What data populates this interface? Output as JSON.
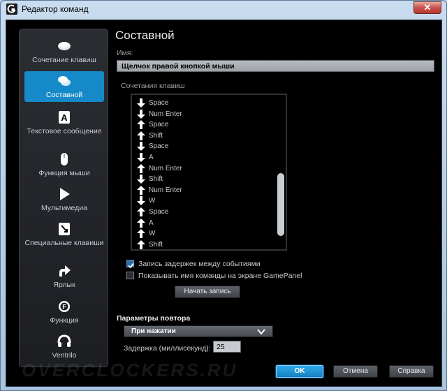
{
  "window": {
    "title": "Редактор команд",
    "close_label": "✕"
  },
  "sidebar": {
    "items": [
      {
        "label": "Сочетание клавиш",
        "icon": "keyboard-keys-icon",
        "active": false
      },
      {
        "label": "Составной",
        "icon": "multikey-icon",
        "active": true
      },
      {
        "label": "Текстовое сообщение",
        "icon": "text-a-icon",
        "active": false
      },
      {
        "label": "Функция мыши",
        "icon": "mouse-icon",
        "active": false
      },
      {
        "label": "Мультимедиа",
        "icon": "play-icon",
        "active": false
      },
      {
        "label": "Специальные клавиши",
        "icon": "special-key-icon",
        "active": false
      },
      {
        "label": "Ярлык",
        "icon": "shortcut-arrow-icon",
        "active": false
      },
      {
        "label": "Функция",
        "icon": "function-f-icon",
        "active": false
      },
      {
        "label": "Ventrilo",
        "icon": "headset-icon",
        "active": false
      }
    ]
  },
  "main": {
    "heading": "Составной",
    "name_label": "Имя:",
    "name_value": "Щелчок правой кнопкой мыши",
    "keys_label": "Сочетания клавиш",
    "key_events": [
      {
        "dir": "down",
        "key": "Space"
      },
      {
        "dir": "down",
        "key": "Num Enter"
      },
      {
        "dir": "up",
        "key": "Space"
      },
      {
        "dir": "up",
        "key": "Shift"
      },
      {
        "dir": "down",
        "key": "Space"
      },
      {
        "dir": "down",
        "key": "A"
      },
      {
        "dir": "up",
        "key": "Num Enter"
      },
      {
        "dir": "down",
        "key": "Shift"
      },
      {
        "dir": "up",
        "key": "Num Enter"
      },
      {
        "dir": "down",
        "key": "W"
      },
      {
        "dir": "up",
        "key": "Space"
      },
      {
        "dir": "up",
        "key": "A"
      },
      {
        "dir": "up",
        "key": "W"
      },
      {
        "dir": "up",
        "key": "Shift"
      }
    ],
    "record_delays_label": "Запись задержек между событиями",
    "record_delays_checked": true,
    "show_name_label": "Показывать имя команды на экране GamePanel",
    "show_name_checked": false,
    "start_record_label": "Начать запись",
    "repeat_section_label": "Параметры повтора",
    "repeat_mode": "При нажатии",
    "delay_label": "Задержка (миллисекунд):",
    "delay_value": "25"
  },
  "footer": {
    "ok_label": "OK",
    "cancel_label": "Отмена",
    "help_label": "Справка",
    "watermark": "OVERCLOCKERS.RU"
  },
  "colors": {
    "accent": "#1689c8",
    "background": "#000000",
    "panel": "#2a2d32"
  }
}
